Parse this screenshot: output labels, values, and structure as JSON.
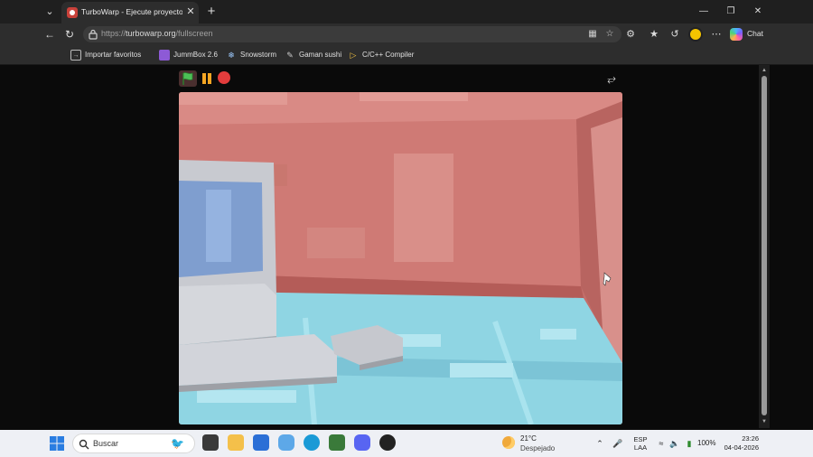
{
  "browser": {
    "tab": {
      "title": "TurboWarp - Ejecute proyectos de"
    },
    "address": {
      "protocol": "https://",
      "domain": "turbowarp.org",
      "path": "/fullscreen"
    },
    "copilot_label": "Chat",
    "bookmarks": [
      {
        "label": "Importar favoritos",
        "icon": "import-icon"
      },
      {
        "label": "JummBox 2.6",
        "icon": "jummbox-icon"
      },
      {
        "label": "Snowstorm",
        "icon": "snowstorm-icon"
      },
      {
        "label": "Gaman sushi",
        "icon": "gaman-icon"
      },
      {
        "label": "C/C++ Compiler",
        "icon": "compiler-icon"
      }
    ]
  },
  "player": {
    "controls": [
      "green-flag",
      "pause",
      "stop"
    ],
    "colors": {
      "wall": "#c9736e",
      "floor": "#8fd5e3",
      "computer": "#c8cad0",
      "screen": "#7f9ecf"
    }
  },
  "taskbar": {
    "search_label": "Buscar",
    "weather": {
      "temp": "21°C",
      "condition": "Despejado"
    },
    "lang": {
      "line1": "ESP",
      "line2": "LAA"
    },
    "battery": "100%",
    "time": "23:26",
    "date": "04-04-2026"
  }
}
